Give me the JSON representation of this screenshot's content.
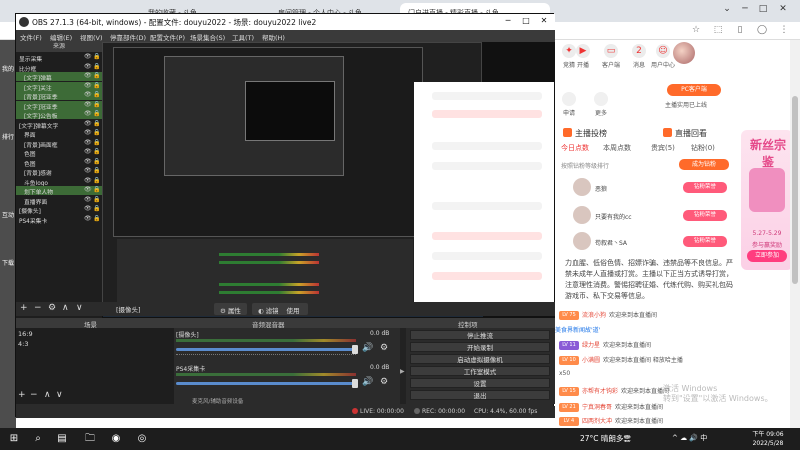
{
  "browser": {
    "tabs": [
      "我的收藏 - 斗鱼",
      "房间管理 - 个人中心 - 斗鱼",
      "门户进直播 - 精彩直播 - 斗鱼"
    ],
    "window_controls": {
      "min": "─",
      "max": "□",
      "close": "✕",
      "chevron": "⌄"
    }
  },
  "site": {
    "top_icons": [
      {
        "label": "竞猜",
        "icon": "guess-icon"
      },
      {
        "label": "开播",
        "icon": "broadcast-icon"
      },
      {
        "label": "客户端",
        "icon": "client-icon"
      },
      {
        "label": "消息",
        "icon": "message-icon"
      },
      {
        "label": "用户中心",
        "icon": "user-icon"
      }
    ],
    "message_badge": "2",
    "apply": "申请",
    "more": "更多",
    "pc_button": "PC客户端",
    "pc_sub": "主播实用已上线",
    "section_rank": "主播投榜",
    "section_live": "直播回看",
    "rank_tabs": [
      "今日点数",
      "本周点数",
      "贵宾(5)",
      "钻粉(0)"
    ],
    "rank_header": "按照钻粉等级排行",
    "rank_more": "成为钻粉",
    "ranks": [
      {
        "name": "恶狼",
        "badge": "钻粉荣誉"
      },
      {
        "name": "只要有我的cc",
        "badge": "钻粉荣誉"
      },
      {
        "name": "苟叙君丶SA",
        "badge": "钻粉荣誉"
      }
    ],
    "promo": {
      "title": "新丝宗鉴",
      "dates": "5.27-5.29",
      "sub": "参与赢奖励",
      "btn": "立即参加"
    },
    "rules_text": "力血腥、低俗色情、招嫖诈骗、违禁品等不良信息。严禁未成年人直播或打赏。主播以下正当方式诱导打赏，注意理性消费。警惕招聘征婚、代练代购、购买礼包码游戏币、私下交易等信息。",
    "chat": [
      {
        "lv": "LV 75",
        "nick": "流浪小狗",
        "text": "欢迎来到本直播间"
      },
      {
        "lv": "",
        "nick": "",
        "text": "美食界新闻故'道'"
      },
      {
        "lv": "LV 11",
        "nick": "绿力星",
        "text": "欢迎来到本直播间"
      },
      {
        "lv": "LV 10",
        "nick": "小满圆",
        "text": "欢迎来到本直播间 释放哈主播"
      },
      {
        "lv": "",
        "nick": "",
        "text": "x50"
      },
      {
        "lv": "LV 15",
        "nick": "亦帮有才钩彩",
        "text": "欢迎来到本直播间"
      },
      {
        "lv": "LV 21",
        "nick": "宁真洞春哥",
        "text": "欢迎来到本直播间"
      },
      {
        "lv": "LV 4",
        "nick": "四两剂大冲",
        "text": "欢迎来到本直播间"
      }
    ],
    "watermark_1": "激活 Windows",
    "watermark_2": "转到\"设置\"以激活 Windows。",
    "left_edge": [
      "我的",
      "排行",
      "互动",
      "下载"
    ]
  },
  "obs": {
    "title": "OBS 27.1.3 (64-bit, windows) - 配置文件: douyu2022 - 场景: douyu2022 live2",
    "menu": [
      "文件(F)",
      "编辑(E)",
      "视图(V)",
      "停靠部件(D)",
      "配置文件(P)",
      "场景集合(S)",
      "工具(T)",
      "帮助(H)"
    ],
    "sources_header": "来源",
    "sources": [
      {
        "name": "显示采集",
        "sel": false
      },
      {
        "name": "比分框",
        "sel": false
      },
      {
        "name": "[文字]弹幕",
        "sel": true
      },
      {
        "name": "[文字]关注",
        "sel": true
      },
      {
        "name": "[背景]冠亚季",
        "sel": true
      },
      {
        "name": "[文字]冠亚季",
        "sel": true
      },
      {
        "name": "[文字]公告板",
        "sel": true
      },
      {
        "name": "[文字]弹幕文字",
        "sel": false
      },
      {
        "name": "界面",
        "sel": false
      },
      {
        "name": "[背景]画面框",
        "sel": false
      },
      {
        "name": "色图",
        "sel": false
      },
      {
        "name": "色图",
        "sel": false
      },
      {
        "name": "[背景]感谢",
        "sel": false
      },
      {
        "name": "斗鱼logo",
        "sel": false
      },
      {
        "name": "划下单人物",
        "sel": true
      },
      {
        "name": "直播界面",
        "sel": false
      },
      {
        "name": "[摄像头]",
        "sel": false
      },
      {
        "name": "PS4采集卡",
        "sel": false
      }
    ],
    "toolbar": {
      "source": "[摄像头]",
      "props": "属性",
      "filters": "滤镜",
      "use": "使用"
    },
    "panels": {
      "scenes": "场景",
      "mixer": "音频混音器",
      "controls": "控制项"
    },
    "scenes": [
      "16:9",
      "4:3"
    ],
    "mixer": [
      {
        "name": "[摄像头]",
        "db": "0.0 dB"
      },
      {
        "name": "PS4采集卡",
        "db": "0.0 dB"
      }
    ],
    "mixer_footer": "麦克风/辅助音频设备",
    "controls": [
      "停止推流",
      "开始录制",
      "启动虚拟摄像机",
      "工作室模式",
      "设置",
      "退出"
    ],
    "status": {
      "live": "LIVE: 00:00:00",
      "rec": "REC: 00:00:00",
      "cpu": "CPU: 4.4%, 60.00 fps"
    }
  },
  "taskbar": {
    "weather": "27°C 晴朗多雲",
    "tray": "^ ☁ 🔊 中",
    "time": "下午 09:06",
    "date": "2022/5/28"
  }
}
